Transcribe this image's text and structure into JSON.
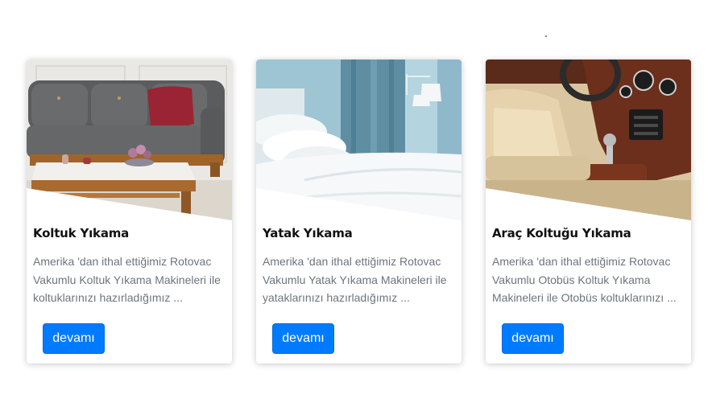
{
  "colors": {
    "primary_button": "#007bff",
    "title_text": "#111111",
    "body_text": "#6c757d"
  },
  "cards": [
    {
      "title": "Koltuk Yıkama",
      "text": "Amerika 'dan ithal ettiğimiz Rotovac Vakumlu Koltuk Yıkama Makineleri ile koltuklarınızı hazırladığımız ...",
      "button": "devamı",
      "image": "grey-sofa-with-wooden-coffee-table"
    },
    {
      "title": "Yatak Yıkama",
      "text": "Amerika 'dan ithal ettiğimiz Rotovac Vakumlu Yatak Yıkama Makineleri ile yataklarınızı hazırladığımız ...",
      "button": "devamı",
      "image": "white-bed-with-blue-curtains"
    },
    {
      "title": "Araç Koltuğu Yıkama",
      "text": "Amerika 'dan ithal ettiğimiz Rotovac Vakumlu Otobüs Koltuk Yıkama Makineleri ile Otobüs koltuklarınızı ...",
      "button": "devamı",
      "image": "beige-leather-car-interior"
    }
  ]
}
